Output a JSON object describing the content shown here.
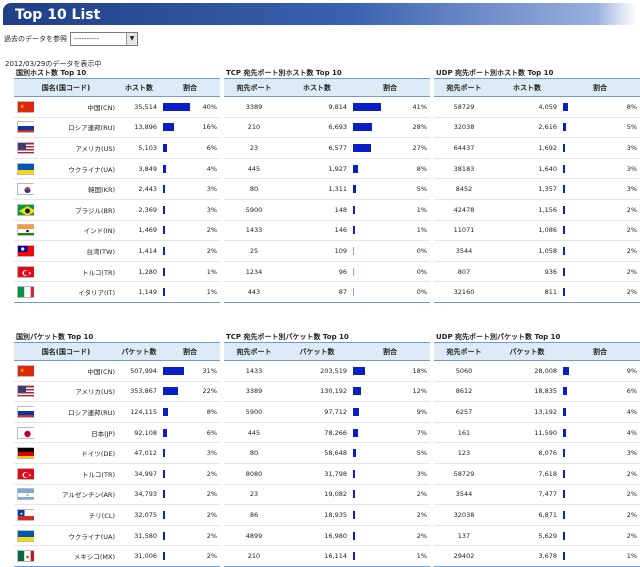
{
  "header": {
    "title": "Top 10 List"
  },
  "past_data": {
    "label": "過去のデータを参照",
    "selected": "----------"
  },
  "display_date": "2012/03/29のデータを表示中",
  "host_panels": [
    {
      "title": "国別ホスト数 Top 10",
      "columns": [
        "国名(国コード)",
        "ホスト数",
        "割合"
      ],
      "rows": [
        {
          "flag": "cn",
          "name": "中国(CN)",
          "count": "35,514",
          "pct_label": "40%",
          "pct": 40
        },
        {
          "flag": "ru",
          "name": "ロシア連邦(RU)",
          "count": "13,896",
          "pct_label": "16%",
          "pct": 16
        },
        {
          "flag": "us",
          "name": "アメリカ(US)",
          "count": "5,103",
          "pct_label": "6%",
          "pct": 6
        },
        {
          "flag": "ua",
          "name": "ウクライナ(UA)",
          "count": "3,849",
          "pct_label": "4%",
          "pct": 4
        },
        {
          "flag": "kr",
          "name": "韓国(KR)",
          "count": "2,443",
          "pct_label": "3%",
          "pct": 3
        },
        {
          "flag": "br",
          "name": "ブラジル(BR)",
          "count": "2,369",
          "pct_label": "3%",
          "pct": 3
        },
        {
          "flag": "in",
          "name": "インド(IN)",
          "count": "1,469",
          "pct_label": "2%",
          "pct": 2
        },
        {
          "flag": "tw",
          "name": "台湾(TW)",
          "count": "1,414",
          "pct_label": "2%",
          "pct": 2
        },
        {
          "flag": "tr",
          "name": "トルコ(TR)",
          "count": "1,280",
          "pct_label": "1%",
          "pct": 1
        },
        {
          "flag": "it",
          "name": "イタリア(IT)",
          "count": "1,149",
          "pct_label": "1%",
          "pct": 1
        }
      ]
    },
    {
      "title": "TCP 宛先ポート別ホスト数 Top 10",
      "columns": [
        "宛先ポート",
        "ホスト数",
        "割合"
      ],
      "rows": [
        {
          "port": "3389",
          "count": "9,814",
          "pct_label": "41%",
          "pct": 41
        },
        {
          "port": "210",
          "count": "6,693",
          "pct_label": "28%",
          "pct": 28
        },
        {
          "port": "23",
          "count": "6,577",
          "pct_label": "27%",
          "pct": 27
        },
        {
          "port": "445",
          "count": "1,927",
          "pct_label": "8%",
          "pct": 8
        },
        {
          "port": "80",
          "count": "1,311",
          "pct_label": "5%",
          "pct": 5
        },
        {
          "port": "5900",
          "count": "148",
          "pct_label": "1%",
          "pct": 1
        },
        {
          "port": "1433",
          "count": "146",
          "pct_label": "1%",
          "pct": 1
        },
        {
          "port": "25",
          "count": "109",
          "pct_label": "0%",
          "pct": 0
        },
        {
          "port": "1234",
          "count": "96",
          "pct_label": "0%",
          "pct": 0
        },
        {
          "port": "443",
          "count": "87",
          "pct_label": "0%",
          "pct": 0
        }
      ]
    },
    {
      "title": "UDP 宛先ポート別ホスト数 Top 10",
      "columns": [
        "宛先ポート",
        "ホスト数",
        "割合"
      ],
      "rows": [
        {
          "port": "58729",
          "count": "4,059",
          "pct_label": "8%",
          "pct": 8
        },
        {
          "port": "32038",
          "count": "2,616",
          "pct_label": "5%",
          "pct": 5
        },
        {
          "port": "64437",
          "count": "1,692",
          "pct_label": "3%",
          "pct": 3
        },
        {
          "port": "38183",
          "count": "1,640",
          "pct_label": "3%",
          "pct": 3
        },
        {
          "port": "8452",
          "count": "1,357",
          "pct_label": "3%",
          "pct": 3
        },
        {
          "port": "42478",
          "count": "1,156",
          "pct_label": "2%",
          "pct": 2
        },
        {
          "port": "11071",
          "count": "1,086",
          "pct_label": "2%",
          "pct": 2
        },
        {
          "port": "3544",
          "count": "1,058",
          "pct_label": "2%",
          "pct": 2
        },
        {
          "port": "807",
          "count": "936",
          "pct_label": "2%",
          "pct": 2
        },
        {
          "port": "32160",
          "count": "811",
          "pct_label": "2%",
          "pct": 2
        }
      ]
    }
  ],
  "packet_panels": [
    {
      "title": "国別パケット数 Top 10",
      "columns": [
        "国名(国コード)",
        "パケット数",
        "割合"
      ],
      "rows": [
        {
          "flag": "cn",
          "name": "中国(CN)",
          "count": "507,994",
          "pct_label": "31%",
          "pct": 31
        },
        {
          "flag": "us",
          "name": "アメリカ(US)",
          "count": "353,867",
          "pct_label": "22%",
          "pct": 22
        },
        {
          "flag": "ru",
          "name": "ロシア連邦(RU)",
          "count": "124,115",
          "pct_label": "8%",
          "pct": 8
        },
        {
          "flag": "jp",
          "name": "日本(JP)",
          "count": "92,108",
          "pct_label": "6%",
          "pct": 6
        },
        {
          "flag": "de",
          "name": "ドイツ(DE)",
          "count": "47,012",
          "pct_label": "3%",
          "pct": 3
        },
        {
          "flag": "tr",
          "name": "トルコ(TR)",
          "count": "34,997",
          "pct_label": "2%",
          "pct": 2
        },
        {
          "flag": "ar",
          "name": "アルゼンチン(AR)",
          "count": "34,793",
          "pct_label": "2%",
          "pct": 2
        },
        {
          "flag": "cl",
          "name": "チリ(CL)",
          "count": "32,075",
          "pct_label": "2%",
          "pct": 2
        },
        {
          "flag": "ua",
          "name": "ウクライナ(UA)",
          "count": "31,580",
          "pct_label": "2%",
          "pct": 2
        },
        {
          "flag": "mx",
          "name": "メキシコ(MX)",
          "count": "31,006",
          "pct_label": "2%",
          "pct": 2
        }
      ]
    },
    {
      "title": "TCP 宛先ポート別パケット数 Top 10",
      "columns": [
        "宛先ポート",
        "パケット数",
        "割合"
      ],
      "rows": [
        {
          "port": "1433",
          "count": "203,519",
          "pct_label": "18%",
          "pct": 18
        },
        {
          "port": "3389",
          "count": "130,192",
          "pct_label": "12%",
          "pct": 12
        },
        {
          "port": "5900",
          "count": "97,712",
          "pct_label": "9%",
          "pct": 9
        },
        {
          "port": "445",
          "count": "78,266",
          "pct_label": "7%",
          "pct": 7
        },
        {
          "port": "80",
          "count": "58,648",
          "pct_label": "5%",
          "pct": 5
        },
        {
          "port": "8080",
          "count": "31,798",
          "pct_label": "3%",
          "pct": 3
        },
        {
          "port": "23",
          "count": "19,082",
          "pct_label": "2%",
          "pct": 2
        },
        {
          "port": "86",
          "count": "18,935",
          "pct_label": "2%",
          "pct": 2
        },
        {
          "port": "4899",
          "count": "16,980",
          "pct_label": "2%",
          "pct": 2
        },
        {
          "port": "210",
          "count": "16,114",
          "pct_label": "1%",
          "pct": 1
        }
      ]
    },
    {
      "title": "UDP 宛先ポート別パケット数 Top 10",
      "columns": [
        "宛先ポート",
        "パケット数",
        "割合"
      ],
      "rows": [
        {
          "port": "5060",
          "count": "28,008",
          "pct_label": "9%",
          "pct": 9
        },
        {
          "port": "8612",
          "count": "18,835",
          "pct_label": "6%",
          "pct": 6
        },
        {
          "port": "6257",
          "count": "13,192",
          "pct_label": "4%",
          "pct": 4
        },
        {
          "port": "161",
          "count": "11,590",
          "pct_label": "4%",
          "pct": 4
        },
        {
          "port": "123",
          "count": "8,076",
          "pct_label": "3%",
          "pct": 3
        },
        {
          "port": "58729",
          "count": "7,618",
          "pct_label": "2%",
          "pct": 2
        },
        {
          "port": "3544",
          "count": "7,477",
          "pct_label": "2%",
          "pct": 2
        },
        {
          "port": "32038",
          "count": "6,871",
          "pct_label": "2%",
          "pct": 2
        },
        {
          "port": "137",
          "count": "5,629",
          "pct_label": "2%",
          "pct": 2
        },
        {
          "port": "29402",
          "count": "3,678",
          "pct_label": "1%",
          "pct": 1
        }
      ]
    }
  ],
  "colors": {
    "header_dark": "#1f3f86",
    "bar": "#0a1ec8",
    "table_header_bg": "#ddebf7",
    "table_border": "#6f9bd3"
  }
}
